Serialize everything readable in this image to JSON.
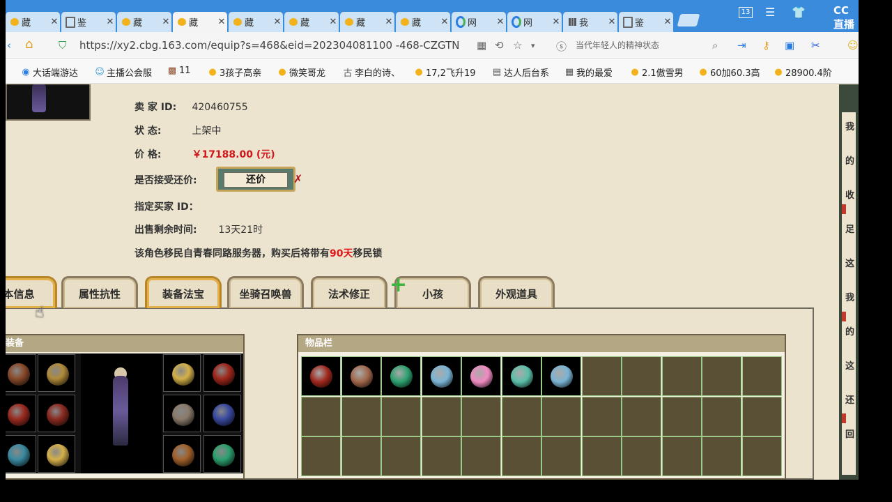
{
  "browser": {
    "tabs": [
      {
        "icon": "duck",
        "title": "藏",
        "active": false
      },
      {
        "icon": "doc",
        "title": "鉴",
        "active": false
      },
      {
        "icon": "duck",
        "title": "藏",
        "active": false
      },
      {
        "icon": "duck",
        "title": "藏",
        "active": true
      },
      {
        "icon": "duck",
        "title": "藏",
        "active": false
      },
      {
        "icon": "duck",
        "title": "藏",
        "active": false
      },
      {
        "icon": "duck",
        "title": "藏",
        "active": false
      },
      {
        "icon": "duck",
        "title": "藏",
        "active": false
      },
      {
        "icon": "web",
        "title": "网",
        "active": false
      },
      {
        "icon": "web",
        "title": "网",
        "active": false
      },
      {
        "icon": "grid",
        "title": "我",
        "active": false
      },
      {
        "icon": "doc",
        "title": "鉴",
        "active": false
      }
    ],
    "tab_count": "13",
    "url": "https://xy2.cbg.163.com/equip?s=468&eid=202304081100 -468-CZGTN",
    "search_placeholder": "当代年轻人的精神状态",
    "overlay_logo": "CC直播",
    "bookmarks": [
      {
        "icon": "web",
        "label": "大话端游达"
      },
      {
        "icon": "face",
        "label": "主播公会服"
      },
      {
        "icon": "pic",
        "label": "11"
      },
      {
        "icon": "duck",
        "label": "3孩子高亲"
      },
      {
        "icon": "duck",
        "label": "微笑哥龙"
      },
      {
        "icon": "gu",
        "label": "李白的诗、"
      },
      {
        "icon": "duck",
        "label": "17,2飞升19"
      },
      {
        "icon": "doc",
        "label": "达人后台系"
      },
      {
        "icon": "grid",
        "label": "我的最爱"
      },
      {
        "icon": "duck",
        "label": "2.1傲雪男"
      },
      {
        "icon": "duck",
        "label": "60加60.3高"
      },
      {
        "icon": "duck",
        "label": "28900.4阶"
      }
    ]
  },
  "listing": {
    "seller_label": "卖  家  ID:",
    "seller_value": "420460755",
    "status_label": "状      态:",
    "status_value": "上架中",
    "price_label": "价      格:",
    "price_value": "￥17188.00 (元)",
    "bargain_label": "是否接受还价:",
    "bargain_button": "还价",
    "buyer_label": "指定买家 ID：",
    "buyer_value": "",
    "remaining_label": "出售剩余时间:",
    "remaining_value": "13天21时",
    "notice_prefix": "该角色移民自青春同路服务器，购买后将带有",
    "notice_highlight": "90天",
    "notice_suffix": "移民锁"
  },
  "char_tabs": [
    {
      "label": "本信息",
      "active": true
    },
    {
      "label": "属性抗性",
      "active": false
    },
    {
      "label": "装备法宝",
      "active": true
    },
    {
      "label": "坐骑召唤兽",
      "active": false
    },
    {
      "label": "法术修正",
      "active": false
    },
    {
      "label": "小孩",
      "active": false
    },
    {
      "label": "外观道具",
      "active": false
    }
  ],
  "equip_panel": {
    "title": "装备",
    "left_slots": [
      "wing-item",
      "necklace",
      "scarf-item",
      "armor",
      "wand-item",
      "boots"
    ],
    "right_slots": [
      "helmet",
      "amulet",
      "ring",
      "belt-ring",
      "belt",
      "jade-orb"
    ]
  },
  "items_panel": {
    "title": "物品栏",
    "rows": 3,
    "cols": 12,
    "items": [
      {
        "name": "red-necklace",
        "color": "#a0271c"
      },
      {
        "name": "feather-wing",
        "color": "#a0664a"
      },
      {
        "name": "green-gem",
        "color": "#2ca06e"
      },
      {
        "name": "ice-cube",
        "color": "#7ab4d4"
      },
      {
        "name": "pink-heart",
        "color": "#f08ac0"
      },
      {
        "name": "jade-card",
        "color": "#5abfa8"
      },
      {
        "name": "ice-cube",
        "color": "#7ab4d4"
      }
    ]
  },
  "right_strip": [
    "我",
    "的",
    "收",
    "足",
    "这",
    "我",
    "的",
    "这",
    "还",
    "回"
  ]
}
